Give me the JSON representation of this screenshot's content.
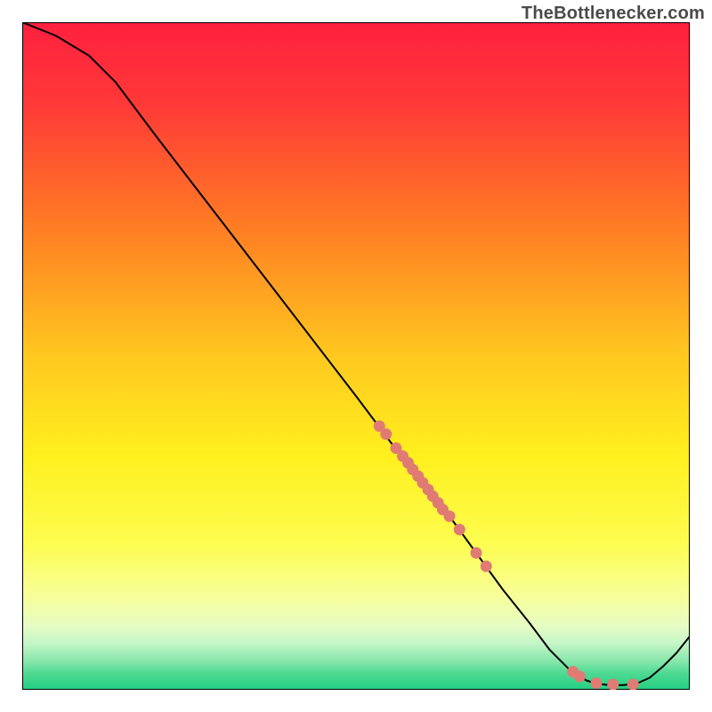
{
  "watermark": "TheBottlenecker.com",
  "chart_data": {
    "type": "line",
    "title": "",
    "xlabel": "",
    "ylabel": "",
    "xlim": [
      0,
      100
    ],
    "ylim": [
      0,
      100
    ],
    "grid": false,
    "legend": false,
    "gradient_stops": [
      {
        "offset": 0.0,
        "color": "#ff203f"
      },
      {
        "offset": 0.12,
        "color": "#ff3838"
      },
      {
        "offset": 0.3,
        "color": "#ff7a24"
      },
      {
        "offset": 0.5,
        "color": "#ffc81f"
      },
      {
        "offset": 0.65,
        "color": "#fff01e"
      },
      {
        "offset": 0.78,
        "color": "#fdfd4f"
      },
      {
        "offset": 0.86,
        "color": "#f7fe9a"
      },
      {
        "offset": 0.905,
        "color": "#e6fcc4"
      },
      {
        "offset": 0.93,
        "color": "#c5f6c8"
      },
      {
        "offset": 0.955,
        "color": "#8de8ad"
      },
      {
        "offset": 0.975,
        "color": "#4fd992"
      },
      {
        "offset": 1.0,
        "color": "#22cf83"
      }
    ],
    "series": [
      {
        "name": "curve",
        "stroke": "#000000",
        "points": [
          {
            "x": 0.0,
            "y": 100.0
          },
          {
            "x": 5.0,
            "y": 98.0
          },
          {
            "x": 10.0,
            "y": 95.0
          },
          {
            "x": 14.0,
            "y": 91.0
          },
          {
            "x": 20.0,
            "y": 83.0
          },
          {
            "x": 30.0,
            "y": 70.0
          },
          {
            "x": 40.0,
            "y": 57.0
          },
          {
            "x": 50.0,
            "y": 44.0
          },
          {
            "x": 56.0,
            "y": 36.0
          },
          {
            "x": 60.0,
            "y": 31.0
          },
          {
            "x": 64.0,
            "y": 26.0
          },
          {
            "x": 68.0,
            "y": 20.5
          },
          {
            "x": 72.0,
            "y": 15.0
          },
          {
            "x": 76.0,
            "y": 10.0
          },
          {
            "x": 79.0,
            "y": 6.0
          },
          {
            "x": 82.0,
            "y": 3.0
          },
          {
            "x": 84.5,
            "y": 1.4
          },
          {
            "x": 86.0,
            "y": 0.9
          },
          {
            "x": 88.0,
            "y": 0.7
          },
          {
            "x": 90.0,
            "y": 0.7
          },
          {
            "x": 92.0,
            "y": 0.9
          },
          {
            "x": 94.0,
            "y": 1.8
          },
          {
            "x": 96.0,
            "y": 3.5
          },
          {
            "x": 98.0,
            "y": 5.5
          },
          {
            "x": 100.0,
            "y": 8.0
          }
        ]
      }
    ],
    "markers": {
      "color": "#e07b73",
      "radius_px": 6.5,
      "points": [
        {
          "x": 53.5,
          "y": 39.5
        },
        {
          "x": 54.5,
          "y": 38.3
        },
        {
          "x": 56.0,
          "y": 36.2
        },
        {
          "x": 57.0,
          "y": 35.0
        },
        {
          "x": 57.8,
          "y": 34.0
        },
        {
          "x": 58.5,
          "y": 33.0
        },
        {
          "x": 59.3,
          "y": 32.0
        },
        {
          "x": 60.0,
          "y": 31.0
        },
        {
          "x": 60.8,
          "y": 30.0
        },
        {
          "x": 61.5,
          "y": 29.0
        },
        {
          "x": 62.3,
          "y": 28.0
        },
        {
          "x": 63.0,
          "y": 27.0
        },
        {
          "x": 64.0,
          "y": 26.0
        },
        {
          "x": 65.5,
          "y": 24.0
        },
        {
          "x": 68.0,
          "y": 20.5
        },
        {
          "x": 69.5,
          "y": 18.5
        },
        {
          "x": 82.5,
          "y": 2.7
        },
        {
          "x": 83.5,
          "y": 2.0
        },
        {
          "x": 86.0,
          "y": 1.0
        },
        {
          "x": 88.5,
          "y": 0.8
        },
        {
          "x": 91.5,
          "y": 0.8
        }
      ]
    }
  }
}
